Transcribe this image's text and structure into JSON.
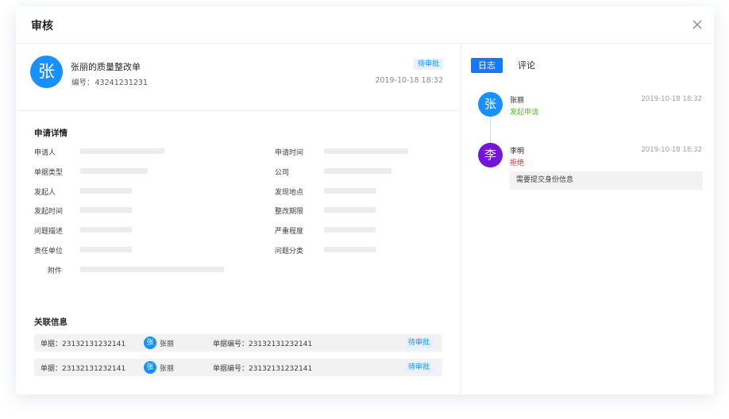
{
  "modal": {
    "title": "审核"
  },
  "doc": {
    "avatar_char": "张",
    "title": "张丽的质量整改单",
    "no_label": "编号：",
    "no_value": "43241231231",
    "status": "待审批",
    "time": "2019-10-18  18:32"
  },
  "details": {
    "title": "申请详情",
    "left_labels": [
      "申请人",
      "单据类型",
      "发起人",
      "发起时间",
      "问题描述",
      "责任单位"
    ],
    "right_labels": [
      "申请时间",
      "公司",
      "发现地点",
      "整改期限",
      "严重程度",
      "问题分类"
    ],
    "attachment_label": "附件"
  },
  "related": {
    "title": "关联信息",
    "rows": [
      {
        "doc": "单据：23132131232141",
        "avatar_char": "张",
        "name": "张丽",
        "no": "单据编号：23132131232141",
        "status": "待审批"
      },
      {
        "doc": "单据：23132131232141",
        "avatar_char": "张",
        "name": "张丽",
        "no": "单据编号：23132131232141",
        "status": "待审批"
      }
    ]
  },
  "tabs": [
    {
      "label": "日志",
      "active": true
    },
    {
      "label": "评论",
      "active": false
    }
  ],
  "log": [
    {
      "avatar_char": "张",
      "avatar_color": "#1890ff",
      "name": "张丽",
      "action": "发起申请",
      "action_color": "#52c41a",
      "time": "2019-10-18  18:32"
    },
    {
      "avatar_char": "李",
      "avatar_color": "#7216d9",
      "name": "李明",
      "action": "拒绝",
      "action_color": "#f5222d",
      "time": "2019-10-18  18:32",
      "comment": "需要提交身份信息"
    }
  ],
  "colors": {
    "primary": "#1677ff",
    "badge_bg": "#e6f0ff",
    "skeleton": "#ececec"
  }
}
